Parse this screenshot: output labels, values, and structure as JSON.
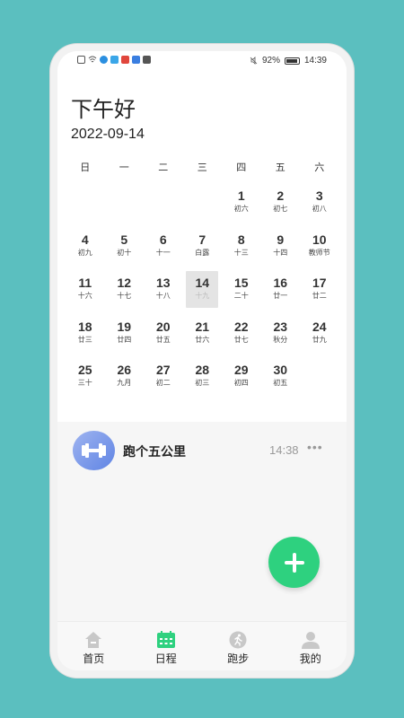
{
  "status_bar": {
    "battery": "92%",
    "time": "14:39",
    "battery_level": 0.92
  },
  "header": {
    "greeting": "下午好",
    "date": "2022-09-14"
  },
  "calendar": {
    "weekdays": [
      "日",
      "一",
      "二",
      "三",
      "四",
      "五",
      "六"
    ],
    "leading_blanks": 4,
    "selected_day": "14",
    "days": [
      {
        "d": "1",
        "l": "初六"
      },
      {
        "d": "2",
        "l": "初七"
      },
      {
        "d": "3",
        "l": "初八"
      },
      {
        "d": "4",
        "l": "初九"
      },
      {
        "d": "5",
        "l": "初十"
      },
      {
        "d": "6",
        "l": "十一"
      },
      {
        "d": "7",
        "l": "白露"
      },
      {
        "d": "8",
        "l": "十三"
      },
      {
        "d": "9",
        "l": "十四"
      },
      {
        "d": "10",
        "l": "教师节"
      },
      {
        "d": "11",
        "l": "十六"
      },
      {
        "d": "12",
        "l": "十七"
      },
      {
        "d": "13",
        "l": "十八"
      },
      {
        "d": "14",
        "l": "十九"
      },
      {
        "d": "15",
        "l": "二十"
      },
      {
        "d": "16",
        "l": "廿一"
      },
      {
        "d": "17",
        "l": "廿二"
      },
      {
        "d": "18",
        "l": "廿三"
      },
      {
        "d": "19",
        "l": "廿四"
      },
      {
        "d": "20",
        "l": "廿五"
      },
      {
        "d": "21",
        "l": "廿六"
      },
      {
        "d": "22",
        "l": "廿七"
      },
      {
        "d": "23",
        "l": "秋分"
      },
      {
        "d": "24",
        "l": "廿九"
      },
      {
        "d": "25",
        "l": "三十"
      },
      {
        "d": "26",
        "l": "九月"
      },
      {
        "d": "27",
        "l": "初二"
      },
      {
        "d": "28",
        "l": "初三"
      },
      {
        "d": "29",
        "l": "初四"
      },
      {
        "d": "30",
        "l": "初五"
      }
    ]
  },
  "event": {
    "title": "跑个五公里",
    "time": "14:38",
    "more": "•••",
    "icon": "dumbbell-icon"
  },
  "fab": {
    "icon": "plus-icon",
    "color": "#2ed17f"
  },
  "tabs": [
    {
      "label": "首页",
      "icon": "home-icon"
    },
    {
      "label": "日程",
      "icon": "calendar-icon",
      "active": true
    },
    {
      "label": "跑步",
      "icon": "running-icon"
    },
    {
      "label": "我的",
      "icon": "user-icon"
    }
  ],
  "colors": {
    "background": "#5bbfbf",
    "accent": "#2ed17f",
    "event_icon": "#6b8de6"
  }
}
